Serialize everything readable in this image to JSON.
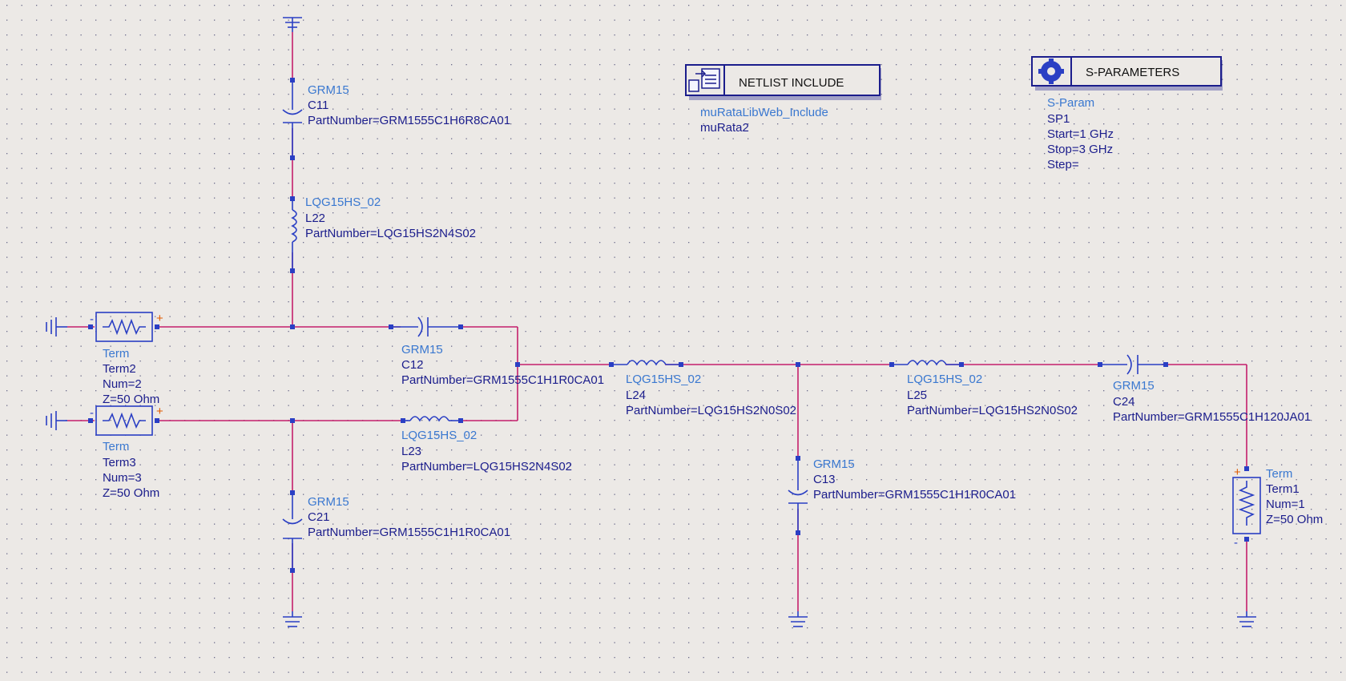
{
  "schematic": {
    "netlist_include": {
      "title": "NETLIST INCLUDE",
      "line1": "muRataLibWeb_Include",
      "line2": "muRata2"
    },
    "sparams": {
      "title": "S-PARAMETERS",
      "line1": "S-Param",
      "line2": "SP1",
      "line3": "Start=1 GHz",
      "line4": "Stop=3 GHz",
      "line5": "Step="
    },
    "c11": {
      "model": "GRM15",
      "name": "C11",
      "part": "PartNumber=GRM1555C1H6R8CA01"
    },
    "l22": {
      "model": "LQG15HS_02",
      "name": "L22",
      "part": "PartNumber=LQG15HS2N4S02"
    },
    "term2": {
      "type": "Term",
      "name": "Term2",
      "num": "Num=2",
      "z": "Z=50 Ohm"
    },
    "term3": {
      "type": "Term",
      "name": "Term3",
      "num": "Num=3",
      "z": "Z=50 Ohm"
    },
    "c12": {
      "model": "GRM15",
      "name": "C12",
      "part": "PartNumber=GRM1555C1H1R0CA01"
    },
    "l23": {
      "model": "LQG15HS_02",
      "name": "L23",
      "part": "PartNumber=LQG15HS2N4S02"
    },
    "c21": {
      "model": "GRM15",
      "name": "C21",
      "part": "PartNumber=GRM1555C1H1R0CA01"
    },
    "l24": {
      "model": "LQG15HS_02",
      "name": "L24",
      "part": "PartNumber=LQG15HS2N0S02"
    },
    "c13": {
      "model": "GRM15",
      "name": "C13",
      "part": "PartNumber=GRM1555C1H1R0CA01"
    },
    "l25": {
      "model": "LQG15HS_02",
      "name": "L25",
      "part": "PartNumber=LQG15HS2N0S02"
    },
    "c24": {
      "model": "GRM15",
      "name": "C24",
      "part": "PartNumber=GRM1555C1H120JA01"
    },
    "term1": {
      "type": "Term",
      "name": "Term1",
      "num": "Num=1",
      "z": "Z=50 Ohm"
    }
  },
  "colors": {
    "wire": "#c41f6b",
    "component": "#2a3fc4",
    "label_model": "#3a78d0",
    "label_value": "#1b1d8c",
    "background": "#ece9e6"
  }
}
